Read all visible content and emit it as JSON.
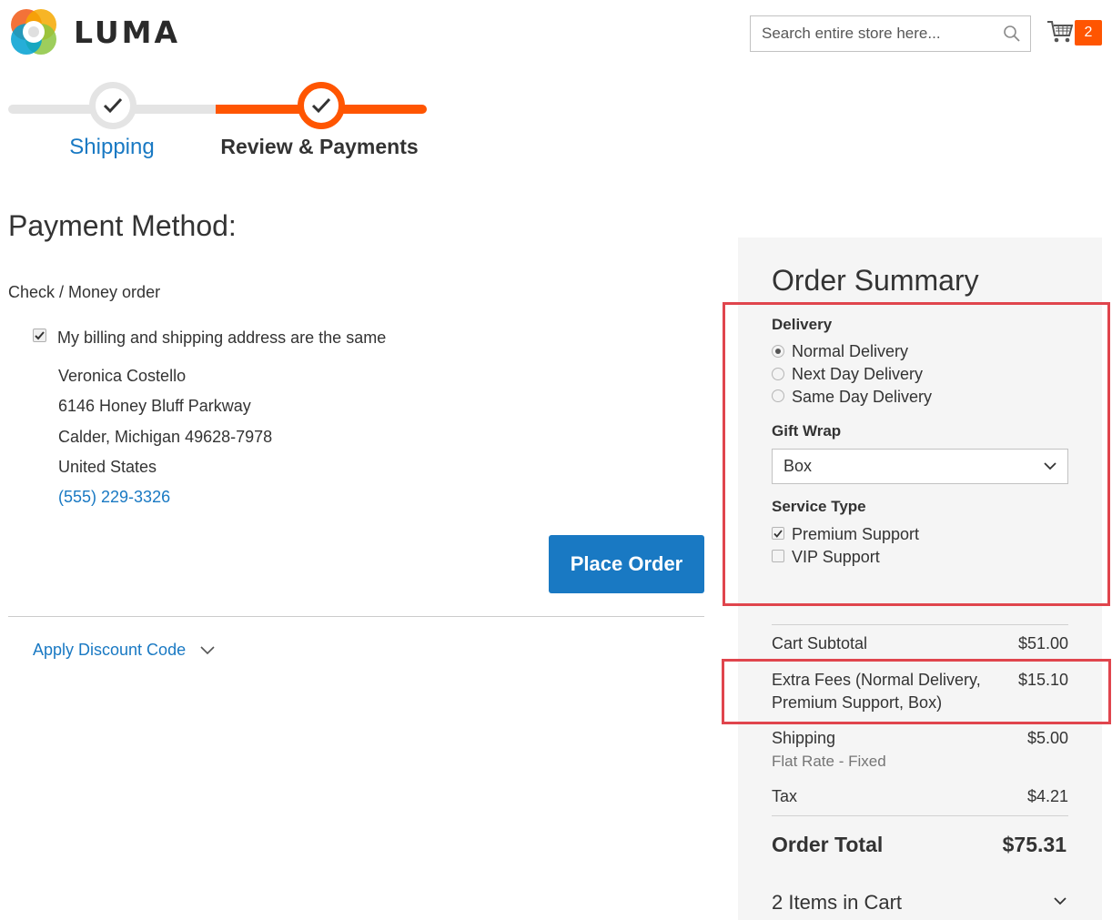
{
  "header": {
    "logo_text": "LUMA",
    "search_placeholder": "Search entire store here...",
    "cart_count": "2"
  },
  "progress": {
    "steps": [
      {
        "label": "Shipping",
        "state": "complete"
      },
      {
        "label": "Review & Payments",
        "state": "active"
      }
    ]
  },
  "payment": {
    "title": "Payment Method:",
    "method": "Check / Money order",
    "billing_same_label": "My billing and shipping address are the same",
    "billing_same_checked": true,
    "address": {
      "name": "Veronica Costello",
      "street": "6146 Honey Bluff Parkway",
      "city": "Calder, Michigan 49628-7978",
      "country": "United States",
      "phone": "(555) 229-3326"
    },
    "place_order_label": "Place Order",
    "discount_label": "Apply Discount Code"
  },
  "summary": {
    "title": "Order Summary",
    "delivery": {
      "label": "Delivery",
      "options": [
        {
          "label": "Normal Delivery",
          "selected": true
        },
        {
          "label": "Next Day Delivery",
          "selected": false
        },
        {
          "label": "Same Day Delivery",
          "selected": false
        }
      ]
    },
    "gift_wrap": {
      "label": "Gift Wrap",
      "value": "Box"
    },
    "service_type": {
      "label": "Service Type",
      "options": [
        {
          "label": "Premium Support",
          "checked": true
        },
        {
          "label": "VIP Support",
          "checked": false
        }
      ]
    },
    "totals": {
      "cart_subtotal_label": "Cart Subtotal",
      "cart_subtotal_value": "$51.00",
      "extra_fees_label_1": "Extra Fees (Normal Delivery,",
      "extra_fees_label_2": "Premium Support, Box)",
      "extra_fees_value": "$15.10",
      "shipping_label": "Shipping",
      "shipping_method": "Flat Rate - Fixed",
      "shipping_value": "$5.00",
      "tax_label": "Tax",
      "tax_value": "$4.21",
      "order_total_label": "Order Total",
      "order_total_value": "$75.31"
    },
    "items_in_cart": "2 Items in Cart"
  },
  "colors": {
    "accent_orange": "#ff5501",
    "link_blue": "#1979c3",
    "highlight_red": "#e0454d"
  }
}
